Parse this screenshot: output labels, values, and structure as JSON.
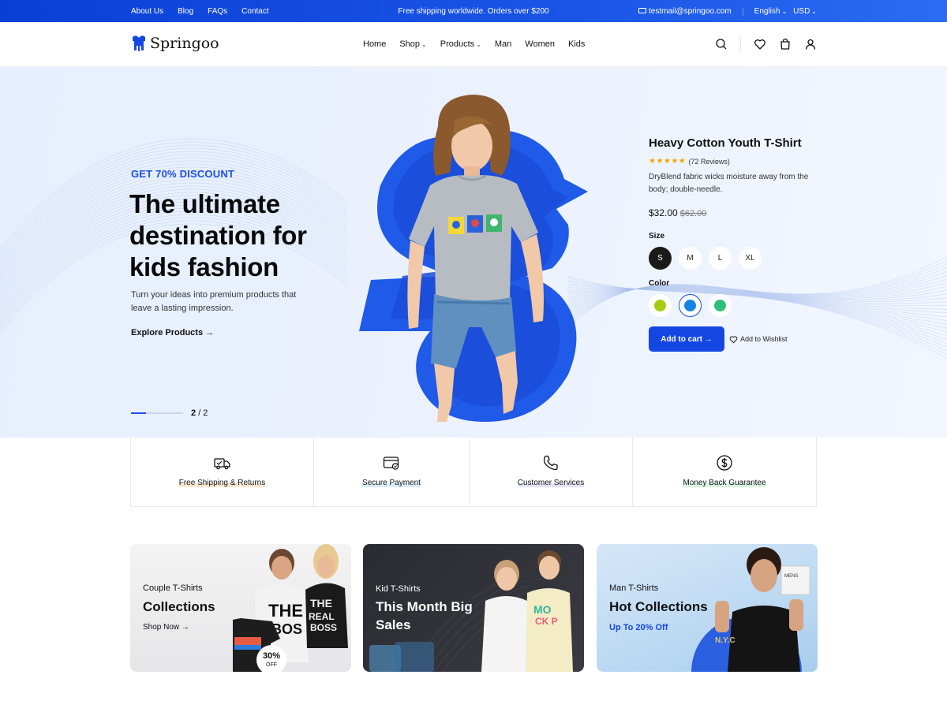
{
  "topbar": {
    "links": [
      "About Us",
      "Blog",
      "FAQs",
      "Contact"
    ],
    "promo": "Free shipping worldwide. Orders over $200",
    "email": "testmail@springoo.com",
    "language": "English",
    "currency": "USD"
  },
  "header": {
    "logo": "Springoo",
    "nav": [
      {
        "label": "Home"
      },
      {
        "label": "Shop"
      },
      {
        "label": "Products"
      },
      {
        "label": "Man"
      },
      {
        "label": "Women"
      },
      {
        "label": "Kids"
      }
    ]
  },
  "hero": {
    "eyebrow": "GET 70% DISCOUNT",
    "headline": "The ultimate destination for kids fashion",
    "subtext": "Turn your ideas into premium products that leave a lasting impression.",
    "cta": "Explore Products →",
    "slide_current": "2",
    "slide_total": "/ 2",
    "slide_progress": 0.29
  },
  "product": {
    "title": "Heavy Cotton Youth T-Shirt",
    "rating_stars": "★★★★★",
    "reviews": "(72 Reviews)",
    "description": "DryBlend fabric wicks moisture away from the body; double-needle.",
    "price": "$32.00",
    "old_price": "$62.00",
    "size_label": "Size",
    "sizes": [
      "S",
      "M",
      "L",
      "XL"
    ],
    "selected_size": "S",
    "color_label": "Color",
    "colors": [
      "#a5cc12",
      "#1584e3",
      "#2dbf7a"
    ],
    "selected_color": "#1584e3",
    "add_to_cart": "Add to cart →",
    "wishlist": "Add to Wishlist"
  },
  "features": [
    {
      "label": "Free Shipping & Returns",
      "icon": "truck-icon"
    },
    {
      "label": "Secure Payment",
      "icon": "card-icon"
    },
    {
      "label": "Customer Services",
      "icon": "phone-icon"
    },
    {
      "label": "Money Back Guarantee",
      "icon": "dollar-icon"
    }
  ],
  "collections": [
    {
      "small": "Couple T-Shirts",
      "big": "Collections",
      "link": "Shop Now →",
      "badge": "30%",
      "badge_sub": "OFF"
    },
    {
      "small": "Kid T-Shirts",
      "big": "This Month Big Sales"
    },
    {
      "small": "Man T-Shirts",
      "big": "Hot Collections",
      "link": "Up To 20% Off"
    }
  ],
  "colors": {
    "topbar": "#1447e2",
    "accent": "#1d4fe0",
    "button": "#1447e2",
    "star": "#f5a400"
  }
}
